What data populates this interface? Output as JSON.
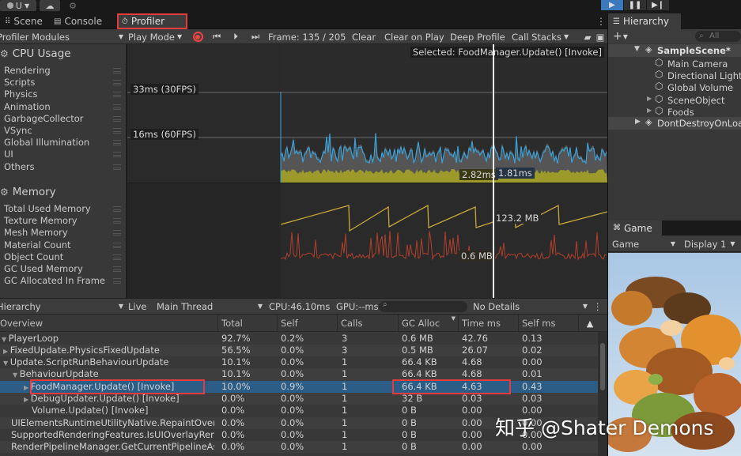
{
  "topbar": {
    "account_label": "U",
    "cloud_icon": "cloud-icon",
    "collab_icon": "collab-icon"
  },
  "play_controls": {
    "play_icon": "play-icon",
    "pause_icon": "pause-icon",
    "step_icon": "step-icon"
  },
  "tabs": {
    "scene": "Scene",
    "console": "Console",
    "profiler": "Profiler",
    "more": "⋮"
  },
  "profiler_toolbar": {
    "modules_dropdown": "Profiler Modules",
    "play_mode": "Play Mode",
    "frame": "Frame: 135 / 205",
    "clear": "Clear",
    "clear_on_play": "Clear on Play",
    "deep_profile": "Deep Profile",
    "call_stacks": "Call Stacks"
  },
  "cpu_module": {
    "title": "CPU Usage",
    "items": [
      "Rendering",
      "Scripts",
      "Physics",
      "Animation",
      "GarbageCollector",
      "VSync",
      "Global Illumination",
      "UI",
      "Others"
    ],
    "colors": [
      "#4c7c2a",
      "#3aa0d8",
      "#e1a82b",
      "#3fc0a4",
      "#a4471e",
      "#e6d94d",
      "#8c7c1f",
      "#3e5fb5",
      "#a49d50"
    ]
  },
  "memory_module": {
    "title": "Memory",
    "items": [
      "Total Used Memory",
      "Texture Memory",
      "Mesh Memory",
      "Material Count",
      "Object Count",
      "GC Used Memory",
      "GC Allocated In Frame"
    ],
    "colors": [
      "#c7a838",
      "#3a73a8",
      "#7fa33a",
      "#7a4bb0",
      "#2f9a9a",
      "#9c3a3a",
      "#c0402a"
    ]
  },
  "cpu_chart": {
    "selected_label": "Selected: FoodManager.Update() [Invoke]",
    "line_33": "33ms (30FPS)",
    "line_16": "16ms (60FPS)",
    "value_a": "2.82ms",
    "value_b": "1.81ms"
  },
  "mem_chart": {
    "value_total": "123.2 MB",
    "value_gc": "0.6 MB"
  },
  "hier_toolbar": {
    "view": "Hierarchy",
    "live": "Live",
    "thread": "Main Thread",
    "cpu": "CPU:46.10ms",
    "gpu": "GPU:--ms",
    "details": "No Details"
  },
  "columns": [
    "Overview",
    "Total",
    "Self",
    "Calls",
    "GC Alloc",
    "Time ms",
    "Self ms"
  ],
  "rows": [
    {
      "name": "PlayerLoop",
      "total": "92.7%",
      "self": "0.2%",
      "calls": "3",
      "gc": "0.6 MB",
      "time": "42.76",
      "selfms": "0.13"
    },
    {
      "name": "FixedUpdate.PhysicsFixedUpdate",
      "total": "56.5%",
      "self": "0.0%",
      "calls": "3",
      "gc": "0.5 MB",
      "time": "26.07",
      "selfms": "0.02"
    },
    {
      "name": "Update.ScriptRunBehaviourUpdate",
      "total": "10.1%",
      "self": "0.0%",
      "calls": "1",
      "gc": "66.4 KB",
      "time": "4.68",
      "selfms": "0.00"
    },
    {
      "name": "BehaviourUpdate",
      "total": "10.1%",
      "self": "0.0%",
      "calls": "1",
      "gc": "66.4 KB",
      "time": "4.68",
      "selfms": "0.01"
    },
    {
      "name": "FoodManager.Update() [Invoke]",
      "total": "10.0%",
      "self": "0.9%",
      "calls": "1",
      "gc": "66.4 KB",
      "time": "4.63",
      "selfms": "0.43"
    },
    {
      "name": "DebugUpdater.Update() [Invoke]",
      "total": "0.0%",
      "self": "0.0%",
      "calls": "1",
      "gc": "32 B",
      "time": "0.03",
      "selfms": "0.03"
    },
    {
      "name": "Volume.Update() [Invoke]",
      "total": "0.0%",
      "self": "0.0%",
      "calls": "1",
      "gc": "0 B",
      "time": "0.00",
      "selfms": "0.00"
    },
    {
      "name": "UIElementsRuntimeUtilityNative.RepaintOverlayPanels",
      "total": "0.0%",
      "self": "0.0%",
      "calls": "1",
      "gc": "0 B",
      "time": "0.00",
      "selfms": "0.00"
    },
    {
      "name": "SupportedRenderingFeatures.IsUIOverlayRenderedBySRP",
      "total": "0.0%",
      "self": "0.0%",
      "calls": "1",
      "gc": "0 B",
      "time": "0.00",
      "selfms": "0.00"
    },
    {
      "name": "RenderPipelineManager.GetCurrentPipelineAsset",
      "total": "0.0%",
      "self": "0.0%",
      "calls": "1",
      "gc": "0 B",
      "time": "0.00",
      "selfms": "0.00"
    }
  ],
  "scene_hierarchy": {
    "title": "Hierarchy",
    "search_placeholder": "All",
    "scene": "SampleScene*",
    "items": [
      "Main Camera",
      "Directional Light",
      "Global Volume",
      "SceneObject",
      "Foods"
    ],
    "dont_destroy": "DontDestroyOnLoad"
  },
  "game": {
    "tab": "Game",
    "view_dropdown": "Game",
    "display": "Display 1"
  },
  "watermark": "知乎 @Shater Demons"
}
